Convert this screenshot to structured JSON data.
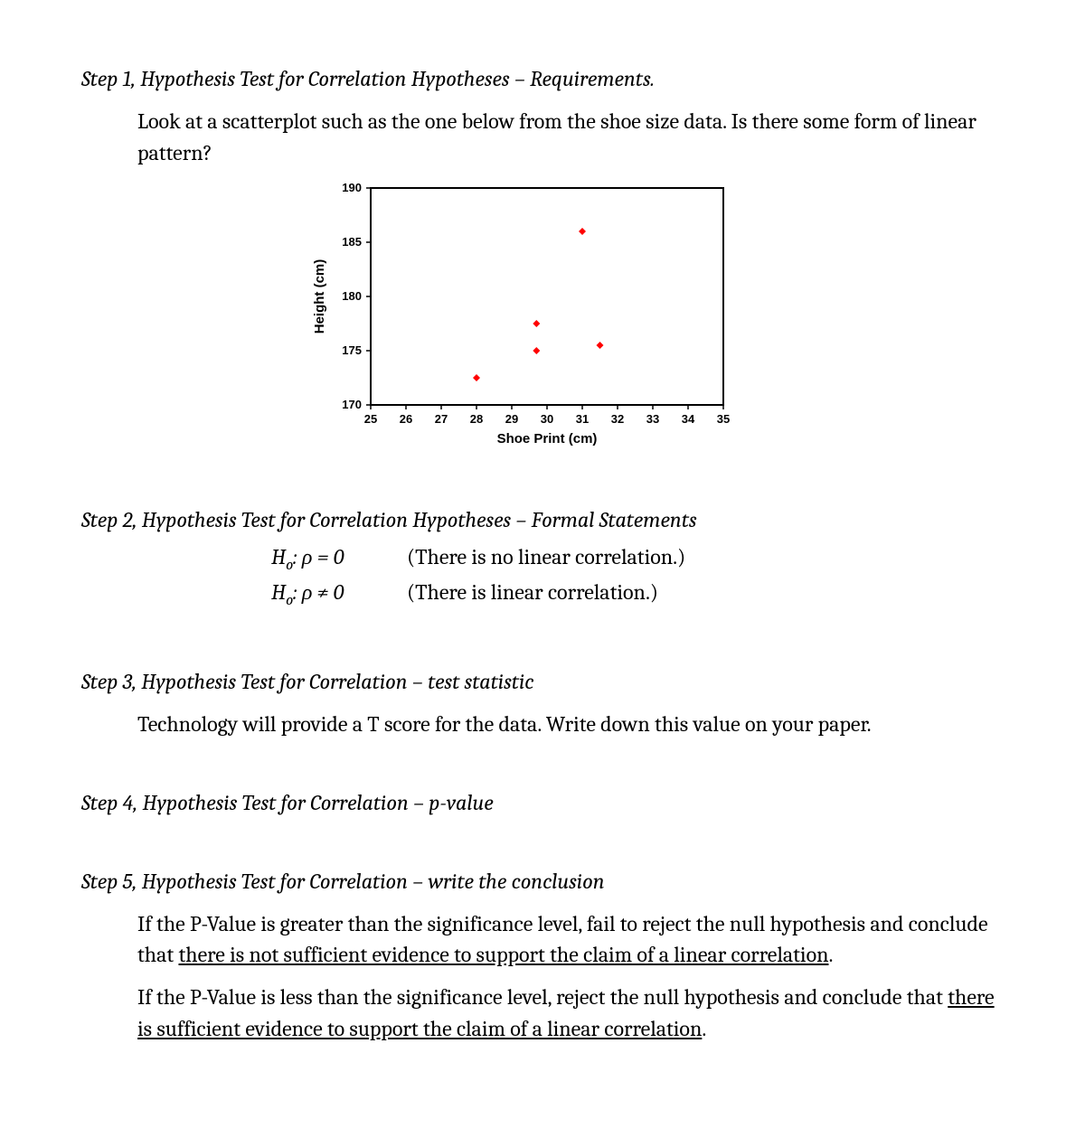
{
  "step1": {
    "heading": "Step 1, Hypothesis Test for Correlation Hypotheses – Requirements.",
    "body": "Look at a scatterplot such as the one below from the shoe size data. Is there some form of linear pattern?"
  },
  "step2": {
    "heading": "Step 2, Hypothesis Test for Correlation Hypotheses – Formal Statements",
    "h0_label": "H",
    "h0_sub": "o",
    "h0_eq": ": ρ = 0",
    "h0_desc": "(There is no linear correlation.)",
    "ha_label": "H",
    "ha_sub": "o",
    "ha_eq": ": ρ ≠ 0",
    "ha_desc": "(There is linear correlation.)"
  },
  "step3": {
    "heading": "Step 3, Hypothesis Test for Correlation – test statistic",
    "body": "Technology will provide a T score for the data. Write down this value on your paper."
  },
  "step4": {
    "heading": "Step 4, Hypothesis Test for Correlation – p-value"
  },
  "step5": {
    "heading": "Step 5, Hypothesis Test for Correlation – write the conclusion",
    "para1_pre": "If the P-Value is greater than the significance level, fail to reject the null hypothesis and conclude that ",
    "para1_u": "there is not sufficient evidence to support the claim of a linear correlation",
    "para1_post": ".",
    "para2_pre": "If the P-Value is less than the significance level, reject the null hypothesis and conclude that ",
    "para2_u": "there is sufficient evidence to support the claim of a linear correlation",
    "para2_post": "."
  },
  "chart_data": {
    "type": "scatter",
    "xlabel": "Shoe Print (cm)",
    "ylabel": "Height (cm)",
    "xlim": [
      25,
      35
    ],
    "ylim": [
      170,
      190
    ],
    "xticks": [
      25,
      26,
      27,
      28,
      29,
      30,
      31,
      32,
      33,
      34,
      35
    ],
    "yticks": [
      170,
      175,
      180,
      185,
      190
    ],
    "points": [
      {
        "x": 28.0,
        "y": 172.5
      },
      {
        "x": 29.7,
        "y": 175.0
      },
      {
        "x": 29.7,
        "y": 177.5
      },
      {
        "x": 31.0,
        "y": 186.0
      },
      {
        "x": 31.5,
        "y": 175.5
      }
    ]
  }
}
